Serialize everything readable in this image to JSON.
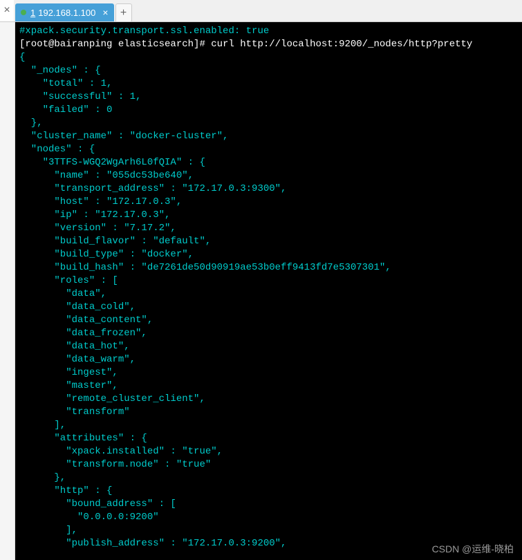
{
  "tabbar": {
    "tab": {
      "number": "1",
      "label": "192.168.1.100"
    },
    "close_x": "×",
    "new_tab_plus": "+"
  },
  "terminal": {
    "config_line": "#xpack.security.transport.ssl.enabled: true",
    "prompt": "[root@bairanping elasticsearch]# ",
    "command": "curl http://localhost:9200/_nodes/http?pretty",
    "open_brace": "{",
    "l1": "  \"_nodes\" : {",
    "l2": "    \"total\" : 1,",
    "l3": "    \"successful\" : 1,",
    "l4": "    \"failed\" : 0",
    "l5": "  },",
    "l6": "  \"cluster_name\" : \"docker-cluster\",",
    "l7": "  \"nodes\" : {",
    "l8": "    \"3TTFS-WGQ2WgArh6L0fQIA\" : {",
    "l9": "      \"name\" : \"055dc53be640\",",
    "l10": "      \"transport_address\" : \"172.17.0.3:9300\",",
    "l11": "      \"host\" : \"172.17.0.3\",",
    "l12": "      \"ip\" : \"172.17.0.3\",",
    "l13": "      \"version\" : \"7.17.2\",",
    "l14": "      \"build_flavor\" : \"default\",",
    "l15": "      \"build_type\" : \"docker\",",
    "l16": "      \"build_hash\" : \"de7261de50d90919ae53b0eff9413fd7e5307301\",",
    "l17": "      \"roles\" : [",
    "l18": "        \"data\",",
    "l19": "        \"data_cold\",",
    "l20": "        \"data_content\",",
    "l21": "        \"data_frozen\",",
    "l22": "        \"data_hot\",",
    "l23": "        \"data_warm\",",
    "l24": "        \"ingest\",",
    "l25": "        \"master\",",
    "l26": "        \"remote_cluster_client\",",
    "l27": "        \"transform\"",
    "l28": "      ],",
    "l29": "      \"attributes\" : {",
    "l30": "        \"xpack.installed\" : \"true\",",
    "l31": "        \"transform.node\" : \"true\"",
    "l32": "      },",
    "l33": "      \"http\" : {",
    "l34": "        \"bound_address\" : [",
    "l35": "          \"0.0.0.0:9200\"",
    "l36": "        ],",
    "l37": "        \"publish_address\" : \"172.17.0.3:9200\","
  },
  "watermark": "CSDN @运维-晓柏"
}
